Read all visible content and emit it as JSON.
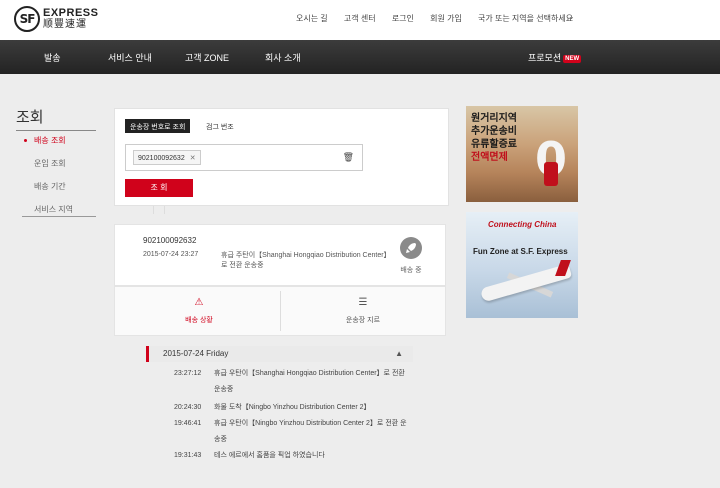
{
  "brand": {
    "logo_mark": "SF",
    "name_en": "EXPRESS",
    "name_zh": "顺豐速運"
  },
  "toplinks": [
    "오시는 길",
    "고객 센터",
    "로그인",
    "회원 가입",
    "국가 또는 지역을 선택하세요"
  ],
  "lang_arrow": "⌄",
  "nav": {
    "items": [
      "발송",
      "서비스 안내",
      "고객 ZONE",
      "회사 소개"
    ],
    "promo": "프로모션",
    "promo_badge": "NEW"
  },
  "sidebar": {
    "title": "조회",
    "items": [
      {
        "label": "배송 조회",
        "active": true
      },
      {
        "label": "운임 조회",
        "active": false
      },
      {
        "label": "배송 기간",
        "active": false
      },
      {
        "label": "서비스 지역",
        "active": false
      }
    ]
  },
  "search": {
    "tab_active": "운송장 번호로 조회",
    "tab_other": "검그 번조",
    "chip_value": "902100092632",
    "chip_close": "✕",
    "trash_icon": "🗑",
    "button": "조 회"
  },
  "result": {
    "waybill": "902100092632",
    "datetime": "2015-07-24 23:27",
    "description": "휴급 주탄이【Shanghai Hongqiao Distribution Center】로 전환 운송중",
    "status_label": "배송 중",
    "status_icon": "rocket-icon"
  },
  "detail_tabs": [
    {
      "label": "배송 상황",
      "icon": "⚠",
      "active": true
    },
    {
      "label": "운송장 지르",
      "icon": "☰",
      "active": false
    }
  ],
  "timeline": {
    "date": "2015-07-24 Friday",
    "caret": "▲",
    "events": [
      {
        "time": "23:27:12",
        "desc": "휴급 우탄이【Shanghai Hongqiao Distribution Center】로 전환 운송중"
      },
      {
        "time": "20:24:30",
        "desc": "화물 도착【Ningbo Yinzhou Distribution Center 2】"
      },
      {
        "time": "19:46:41",
        "desc": "휴급 우탄이【Ningbo Yinzhou Distribution Center 2】로 전환 운송중"
      },
      {
        "time": "19:31:43",
        "desc": "테스 에르에서 홈품을 픽업 하였습니다"
      }
    ]
  },
  "ads": {
    "ad1": {
      "lines": [
        "원거리지역",
        "추가운송비",
        "유류할증료"
      ],
      "highlight": "전액면제",
      "big": "0"
    },
    "ad2": {
      "logo": "Connecting China",
      "caption": "Fun Zone at S.F. Express"
    }
  },
  "colors": {
    "accent": "#d0021b",
    "nav_bg": "#2b2b2b",
    "page_bg": "#ededed"
  }
}
